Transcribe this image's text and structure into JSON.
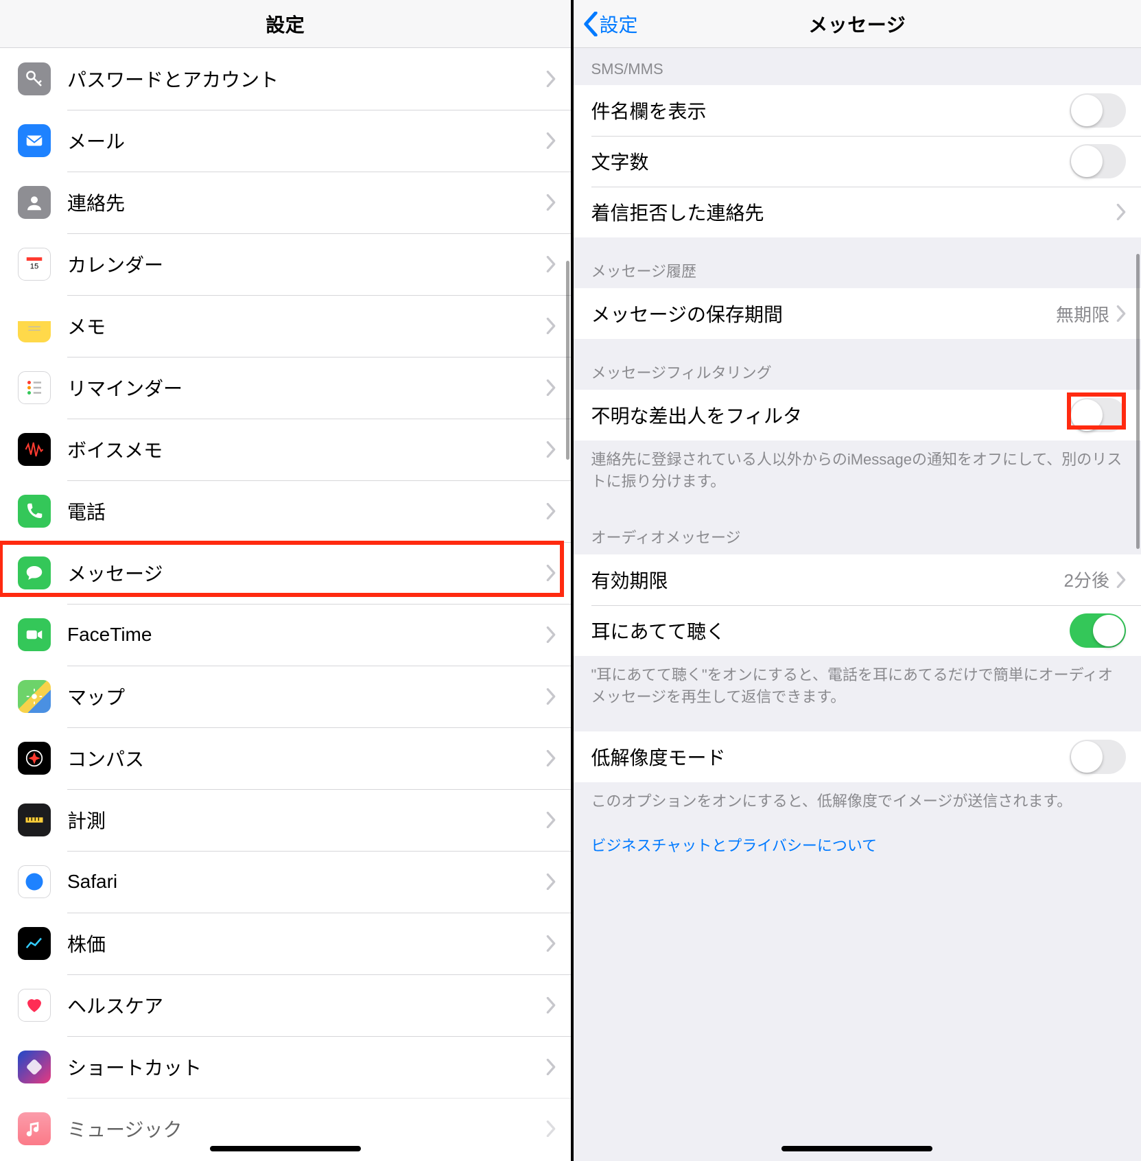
{
  "left": {
    "title": "設定",
    "items": [
      {
        "id": "passwords",
        "label": "パスワードとアカウント",
        "icon": "key-icon",
        "bg": "ic-gray"
      },
      {
        "id": "mail",
        "label": "メール",
        "icon": "mail-icon",
        "bg": "ic-blue"
      },
      {
        "id": "contacts",
        "label": "連絡先",
        "icon": "contacts-icon",
        "bg": "ic-gray"
      },
      {
        "id": "calendar",
        "label": "カレンダー",
        "icon": "calendar-icon",
        "bg": "ic-white"
      },
      {
        "id": "notes",
        "label": "メモ",
        "icon": "notes-icon",
        "bg": "ic-yellow"
      },
      {
        "id": "reminders",
        "label": "リマインダー",
        "icon": "reminders-icon",
        "bg": "ic-white"
      },
      {
        "id": "voicememos",
        "label": "ボイスメモ",
        "icon": "voicememo-icon",
        "bg": "ic-black"
      },
      {
        "id": "phone",
        "label": "電話",
        "icon": "phone-icon",
        "bg": "ic-green"
      },
      {
        "id": "messages",
        "label": "メッセージ",
        "icon": "messages-icon",
        "bg": "ic-green",
        "highlighted": true
      },
      {
        "id": "facetime",
        "label": "FaceTime",
        "icon": "facetime-icon",
        "bg": "ic-green"
      },
      {
        "id": "maps",
        "label": "マップ",
        "icon": "maps-icon",
        "bg": "ic-maps"
      },
      {
        "id": "compass",
        "label": "コンパス",
        "icon": "compass-icon",
        "bg": "ic-black"
      },
      {
        "id": "measure",
        "label": "計測",
        "icon": "measure-icon",
        "bg": "ic-dark"
      },
      {
        "id": "safari",
        "label": "Safari",
        "icon": "safari-icon",
        "bg": "ic-safari"
      },
      {
        "id": "stocks",
        "label": "株価",
        "icon": "stocks-icon",
        "bg": "ic-black"
      },
      {
        "id": "health",
        "label": "ヘルスケア",
        "icon": "health-icon",
        "bg": "ic-white"
      },
      {
        "id": "shortcuts",
        "label": "ショートカット",
        "icon": "shortcuts-icon",
        "bg": "ic-shortcut"
      },
      {
        "id": "music",
        "label": "ミュージック",
        "icon": "music-icon",
        "bg": "ic-music",
        "partial": true
      }
    ]
  },
  "right": {
    "title": "メッセージ",
    "back_label": "設定",
    "sections": {
      "sms": {
        "header": "SMS/MMS",
        "show_subject": {
          "label": "件名欄を表示",
          "on": false
        },
        "char_count": {
          "label": "文字数",
          "on": false
        },
        "blocked": {
          "label": "着信拒否した連絡先"
        }
      },
      "history": {
        "header": "メッセージ履歴",
        "keep": {
          "label": "メッセージの保存期間",
          "value": "無期限"
        }
      },
      "filter": {
        "header": "メッセージフィルタリング",
        "unknown": {
          "label": "不明な差出人をフィルタ",
          "on": false,
          "highlighted": true
        },
        "footer": "連絡先に登録されている人以外からのiMessageの通知をオフにして、別のリストに振り分けます。"
      },
      "audio": {
        "header": "オーディオメッセージ",
        "expire": {
          "label": "有効期限",
          "value": "2分後"
        },
        "raise": {
          "label": "耳にあてて聴く",
          "on": true
        },
        "footer": "\"耳にあてて聴く\"をオンにすると、電話を耳にあてるだけで簡単にオーディオメッセージを再生して返信できます。"
      },
      "lowres": {
        "toggle": {
          "label": "低解像度モード",
          "on": false
        },
        "footer": "このオプションをオンにすると、低解像度でイメージが送信されます。"
      },
      "link": "ビジネスチャットとプライバシーについて"
    }
  }
}
